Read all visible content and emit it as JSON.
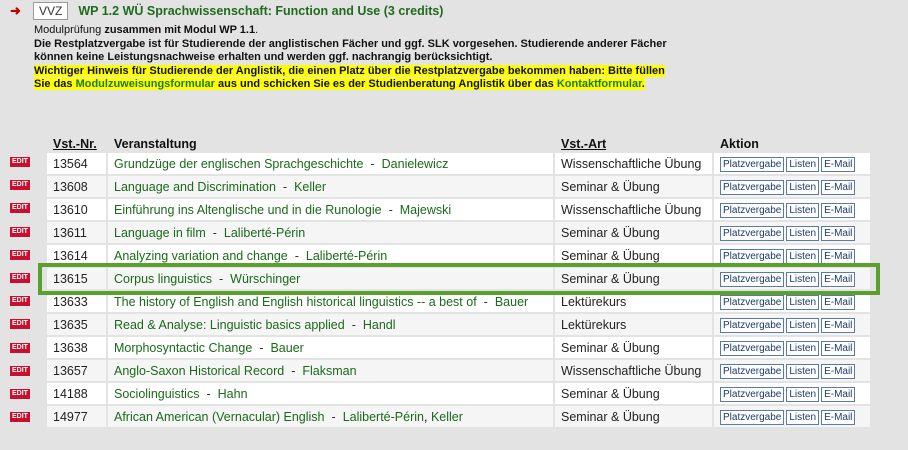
{
  "header": {
    "vvz_label": "VVZ",
    "module_title": "WP 1.2 WÜ Sprachwissenschaft: Function and Use (3 credits)"
  },
  "info": {
    "line1_prefix": "Modulprüfung ",
    "line1_bold": "zusammen mit Modul WP 1.1",
    "line1_suffix": ".",
    "line2": "Die Restplatzvergabe ist für Studierende der anglistischen Fächer und ggf. SLK vorgesehen. Studierende anderer Fächer",
    "line3": "können keine Leistungsnachweise erhalten und werden ggf. nachrangig berücksichtigt.",
    "notice_line1": "Wichtiger Hinweis für Studierende der Anglistik, die einen Platz über die Restplatzvergabe bekommen haben: Bitte füllen",
    "notice_line2_a": "Sie das ",
    "notice_link1": "Modulzuweisungsformular",
    "notice_line2_b": " aus und schicken Sie es der Studienberatung Anglistik über das ",
    "notice_link2": "Kontaktformular",
    "notice_line2_c": "."
  },
  "table": {
    "headers": {
      "nr": "Vst.-Nr.",
      "title": "Veranstaltung",
      "art": "Vst.-Art",
      "action": "Aktion"
    },
    "buttons": {
      "platz": "Platzvergabe",
      "listen": "Listen",
      "email": "E-Mail"
    },
    "edit_label": "EDIT",
    "sep": "-",
    "rows": [
      {
        "nr": "13564",
        "title": "Grundzüge der englischen Sprachgeschichte",
        "lecturer": "Danielewicz",
        "art": "Wissenschaftliche Übung"
      },
      {
        "nr": "13608",
        "title": "Language and Discrimination",
        "lecturer": "Keller",
        "art": "Seminar & Übung"
      },
      {
        "nr": "13610",
        "title": "Einführung ins Altenglische und in die Runologie",
        "lecturer": "Majewski",
        "art": "Wissenschaftliche Übung"
      },
      {
        "nr": "13611",
        "title": "Language in film",
        "lecturer": "Laliberté-Périn",
        "art": "Seminar & Übung"
      },
      {
        "nr": "13614",
        "title": "Analyzing variation and change",
        "lecturer": "Laliberté-Périn",
        "art": "Seminar & Übung"
      },
      {
        "nr": "13615",
        "title": "Corpus linguistics",
        "lecturer": "Würschinger",
        "art": "Seminar & Übung"
      },
      {
        "nr": "13633",
        "title": "The history of English and English historical linguistics -- a best of",
        "lecturer": "Bauer",
        "art": "Lektürekurs"
      },
      {
        "nr": "13635",
        "title": "Read & Analyse: Linguistic basics applied",
        "lecturer": "Handl",
        "art": "Lektürekurs"
      },
      {
        "nr": "13638",
        "title": "Morphosyntactic Change",
        "lecturer": "Bauer",
        "art": "Seminar & Übung"
      },
      {
        "nr": "13657",
        "title": "Anglo-Saxon Historical Record",
        "lecturer": "Flaksman",
        "art": "Wissenschaftliche Übung"
      },
      {
        "nr": "14188",
        "title": "Sociolinguistics",
        "lecturer": "Hahn",
        "art": "Seminar & Übung"
      },
      {
        "nr": "14977",
        "title": "African American (Vernacular) English",
        "lecturer": "Laliberté-Périn",
        "lecturer2": "Keller",
        "art": "Seminar & Übung"
      }
    ]
  },
  "highlight_color": "#5aa02c"
}
